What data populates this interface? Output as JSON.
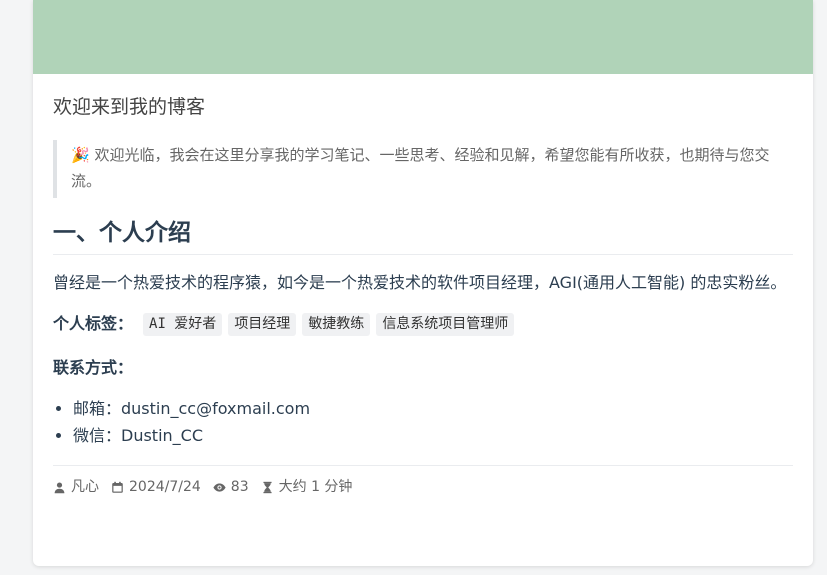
{
  "colors": {
    "cover": "#b0d3b8",
    "accent": "#2c3e50"
  },
  "post": {
    "title": "欢迎来到我的博客",
    "notice_icon": "party-popper-icon",
    "notice": "🎉 欢迎光临，我会在这里分享我的学习笔记、一些思考、经验和见解，希望您能有所收获，也期待与您交流。",
    "section_title": "一、个人介绍",
    "intro": "曾经是一个热爱技术的程序猿，如今是一个热爱技术的软件项目经理，AGI(通用人工智能) 的忠实粉丝。",
    "tags_label": "个人标签：",
    "tags": [
      "AI 爱好者",
      "项目经理",
      "敏捷教练",
      "信息系统项目管理师"
    ],
    "contact_label": "联系方式：",
    "contacts": [
      "邮箱：dustin_cc@foxmail.com",
      "微信：Dustin_CC"
    ]
  },
  "footer": {
    "author": "凡心",
    "date": "2024/7/24",
    "views": "83",
    "reading_time": "大约 1 分钟"
  }
}
